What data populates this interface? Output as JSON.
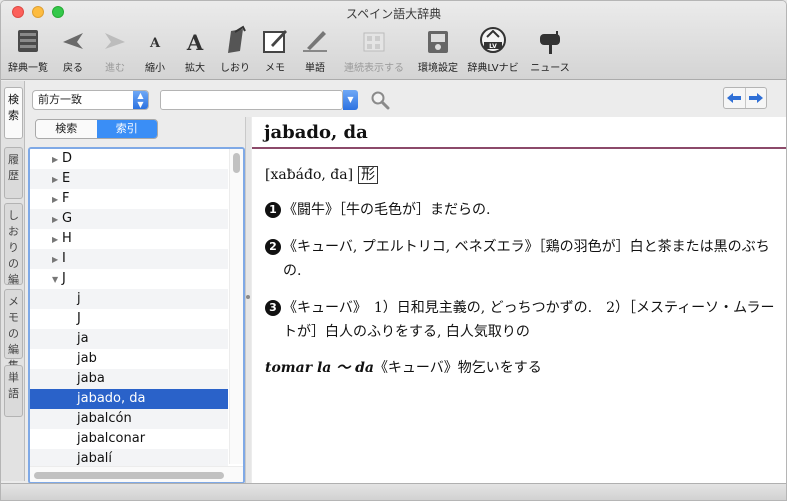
{
  "window": {
    "title": "スペイン語大辞典"
  },
  "toolbar": {
    "items": [
      {
        "label": "辞典一覧",
        "icon": "dictionary-list-icon",
        "enabled": true
      },
      {
        "label": "戻る",
        "icon": "back-arrow-icon",
        "enabled": true
      },
      {
        "label": "進む",
        "icon": "forward-arrow-icon",
        "enabled": false
      },
      {
        "label": "縮小",
        "icon": "font-smaller-icon",
        "enabled": true
      },
      {
        "label": "拡大",
        "icon": "font-larger-icon",
        "enabled": true
      },
      {
        "label": "しおり",
        "icon": "bookmark-icon",
        "enabled": true
      },
      {
        "label": "メモ",
        "icon": "memo-icon",
        "enabled": true
      },
      {
        "label": "単語",
        "icon": "word-icon",
        "enabled": true
      },
      {
        "label": "連続表示する",
        "icon": "continuous-display-icon",
        "enabled": false
      },
      {
        "label": "環境設定",
        "icon": "preferences-icon",
        "enabled": true
      },
      {
        "label": "辞典LVナビ",
        "icon": "lv-navi-icon",
        "enabled": true
      },
      {
        "label": "ニュース",
        "icon": "mailbox-icon",
        "enabled": true
      }
    ]
  },
  "side_tabs": [
    {
      "label": "検索",
      "active": true
    },
    {
      "label": "履歴",
      "active": false
    },
    {
      "label": "しおりの編集",
      "active": false
    },
    {
      "label": "メモの編集",
      "active": false
    },
    {
      "label": "単語",
      "active": false
    }
  ],
  "search": {
    "mode": "前方一致",
    "query": "",
    "placeholder": ""
  },
  "segment": {
    "tabs": [
      "検索",
      "索引"
    ],
    "active": "索引"
  },
  "index_list": {
    "items": [
      {
        "text": "D",
        "type": "group",
        "expanded": false
      },
      {
        "text": "E",
        "type": "group",
        "expanded": false
      },
      {
        "text": "F",
        "type": "group",
        "expanded": false
      },
      {
        "text": "G",
        "type": "group",
        "expanded": false
      },
      {
        "text": "H",
        "type": "group",
        "expanded": false
      },
      {
        "text": "I",
        "type": "group",
        "expanded": false
      },
      {
        "text": "J",
        "type": "group",
        "expanded": true
      },
      {
        "text": "j",
        "type": "child"
      },
      {
        "text": "J",
        "type": "child"
      },
      {
        "text": "ja",
        "type": "child"
      },
      {
        "text": "jab",
        "type": "child"
      },
      {
        "text": "jaba",
        "type": "child"
      },
      {
        "text": "jabado, da",
        "type": "child",
        "selected": true
      },
      {
        "text": "jabalcón",
        "type": "child"
      },
      {
        "text": "jabalconar",
        "type": "child"
      },
      {
        "text": "jabalí",
        "type": "child"
      }
    ]
  },
  "entry": {
    "headword": "jabado, da",
    "pronunciation": "[xaƀáđo, đa]",
    "pos": "形",
    "senses": [
      {
        "num": "1",
        "text": "《闘牛》［牛の毛色が］まだらの."
      },
      {
        "num": "2",
        "text": "《キューバ, プエルトリコ, ベネズエラ》［鶏の羽色が］白と茶または黒のぶちの."
      },
      {
        "num": "3",
        "text": "《キューバ》　1）日和見主義の, どっちつかずの.　2）［メスティーソ・ムラートが］白人のふりをする, 白人気取りの"
      }
    ],
    "phrase": {
      "expression": "tomar la ～ da",
      "gloss": "《キューバ》物乞いをする"
    }
  },
  "colors": {
    "accent": "#3a8ef6",
    "selection": "#2a62c9",
    "entry_rule": "#8c4a6a"
  }
}
